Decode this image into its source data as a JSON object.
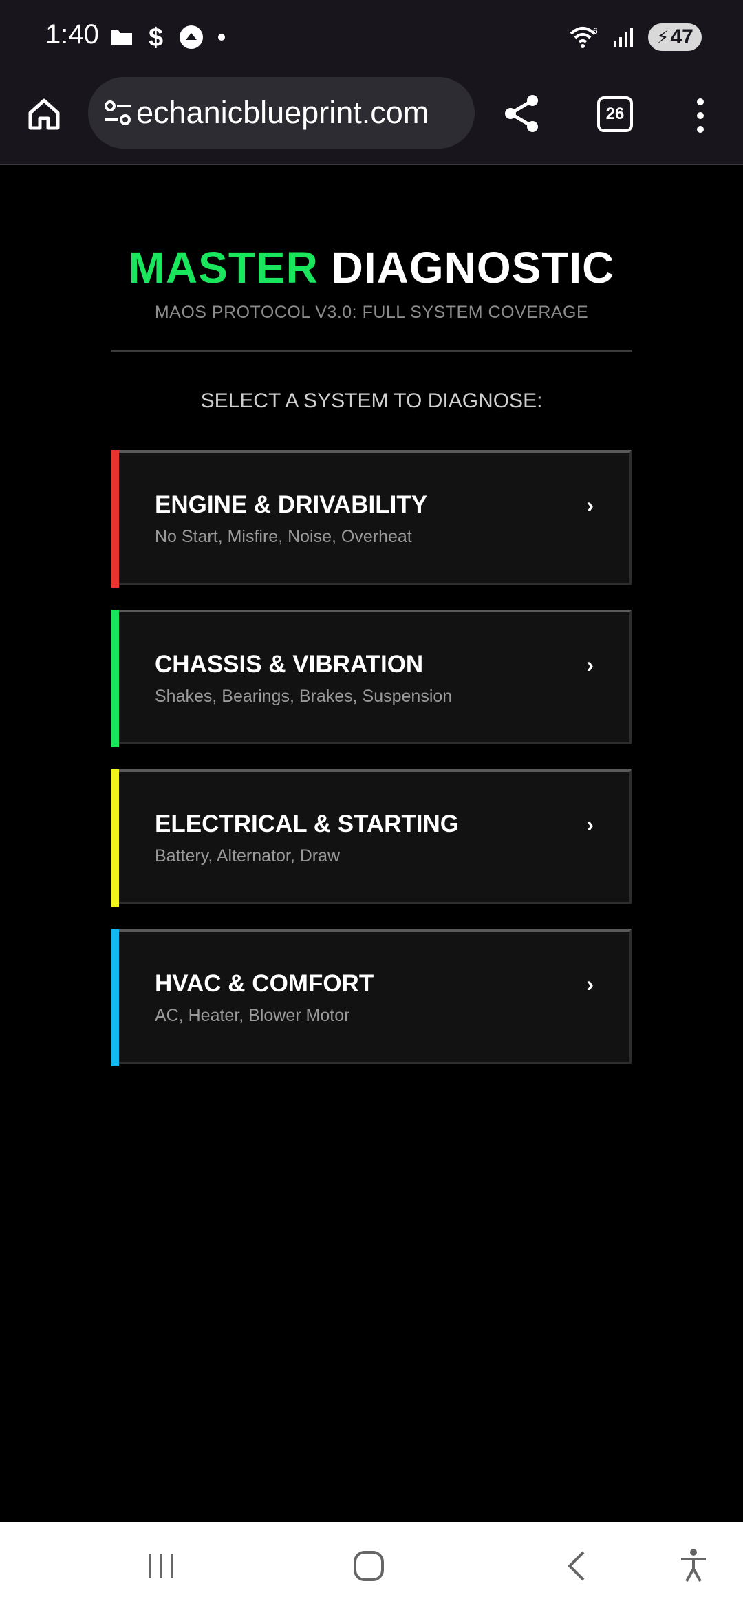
{
  "status_bar": {
    "time": "1:40",
    "left_icons": [
      "folder-icon",
      "dollar-icon",
      "upload-icon",
      "dot-icon"
    ],
    "right_icons": [
      "wifi-icon",
      "signal-icon"
    ],
    "wifi_label": "6",
    "battery_level": "47"
  },
  "browser": {
    "url": "echanicblueprint.com",
    "tab_count": "26"
  },
  "page": {
    "title_accent": "MASTER",
    "title_main": "DIAGNOSTIC",
    "subtitle": "MAOS PROTOCOL V3.0: FULL SYSTEM COVERAGE",
    "prompt": "SELECT A SYSTEM TO DIAGNOSE:",
    "accent_color": "#19e65c",
    "systems": [
      {
        "title": "ENGINE & DRIVABILITY",
        "subtitle": "No Start, Misfire, Noise, Overheat",
        "chevron": "›",
        "color": "#e8332e"
      },
      {
        "title": "CHASSIS & VIBRATION",
        "subtitle": "Shakes, Bearings, Brakes, Suspension",
        "chevron": "›",
        "color": "#19e65c"
      },
      {
        "title": "ELECTRICAL & STARTING",
        "subtitle": "Battery, Alternator, Draw",
        "chevron": "›",
        "color": "#f2f21d"
      },
      {
        "title": "HVAC & COMFORT",
        "subtitle": "AC, Heater, Blower Motor",
        "chevron": "›",
        "color": "#12b8f0"
      }
    ]
  },
  "nav_bar": {
    "buttons": [
      "recents-icon",
      "home-icon",
      "back-icon",
      "accessibility-icon"
    ]
  }
}
